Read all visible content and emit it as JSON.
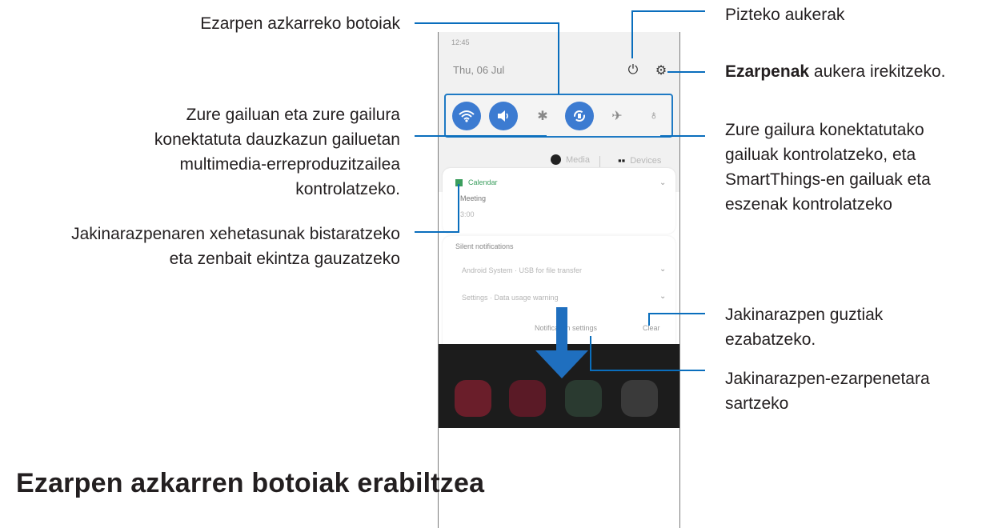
{
  "labels": {
    "quick_buttons": "Ezarpen azkarreko botoiak",
    "media_line1": "Zure gailuan eta zure gailura",
    "media_line2": "konektatuta dauzkazun gailuetan",
    "media_line3": "multimedia-erreproduzitzailea",
    "media_line4": "kontrolatzeko.",
    "notif_line1": "Jakinarazpenaren xehetasunak bistaratzeko",
    "notif_line2": "eta zenbait ekintza gauzatzeko",
    "power": "Pizteko aukerak",
    "settings_bold": "Ezarpenak",
    "settings_rest": " aukera irekitzeko.",
    "devices_line1": "Zure gailura konektatutako",
    "devices_line2": "gailuak kontrolatzeko, eta",
    "devices_line3": "SmartThings-en gailuak eta",
    "devices_line4": "eszenak kontrolatzeko",
    "clear_line1": "Jakinarazpen guztiak",
    "clear_line2": "ezabatzeko.",
    "notif_settings_line1": "Jakinarazpen-ezarpenetara",
    "notif_settings_line2": "sartzeko"
  },
  "heading": "Ezarpen azkarren botoiak erabiltzea",
  "phone": {
    "time": "12:45",
    "date": "Thu, 06 Jul",
    "media_label": "Media",
    "devices_label": "Devices",
    "notification_app": "Calendar",
    "notification_title": "Meeting",
    "notification_sub": "3:00",
    "silent_header": "Silent notifications",
    "silent_item1": "Android System · USB for file transfer",
    "silent_item2": "Settings · Data usage warning",
    "notif_settings_btn": "Notification settings",
    "clear_btn": "Clear"
  },
  "colors": {
    "accent": "#0a6ebd",
    "toggle_on": "#3c7bd1"
  },
  "icons": {
    "power": "power-icon",
    "settings": "gear-icon",
    "wifi": "wifi-icon",
    "sound": "sound-icon",
    "bluetooth": "bluetooth-icon",
    "rotate": "auto-rotate-icon",
    "airplane": "airplane-icon",
    "flashlight": "flashlight-icon"
  }
}
